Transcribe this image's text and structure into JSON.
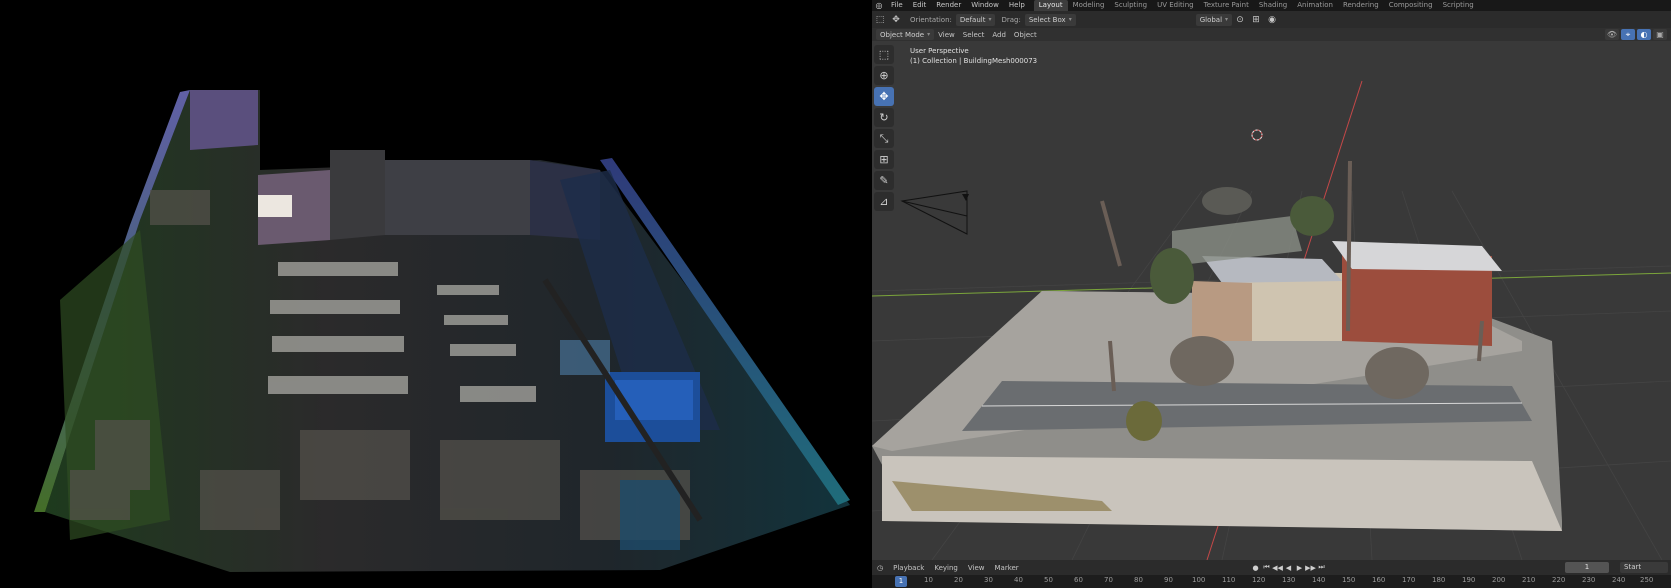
{
  "blender": {
    "menu": [
      "File",
      "Edit",
      "Render",
      "Window",
      "Help"
    ],
    "workspaces": [
      "Layout",
      "Modeling",
      "Sculpting",
      "UV Editing",
      "Texture Paint",
      "Shading",
      "Animation",
      "Rendering",
      "Compositing",
      "Scripting"
    ],
    "active_workspace": "Layout",
    "tool_header": {
      "orientation_label": "Orientation:",
      "orientation_value": "Default",
      "drag_label": "Drag:",
      "drag_value": "Select Box",
      "transform_value": "Global"
    },
    "viewport_header": {
      "mode": "Object Mode",
      "menus": [
        "View",
        "Select",
        "Add",
        "Object"
      ]
    },
    "viewport_overlay": {
      "line1": "User Perspective",
      "line2": "(1) Collection | BuildingMesh000073"
    },
    "toolbar_icons": [
      "select-box-icon",
      "cursor-icon",
      "move-icon",
      "rotate-icon",
      "scale-icon",
      "transform-icon",
      "annotate-icon",
      "measure-icon"
    ],
    "timeline": {
      "menus": [
        "Playback",
        "Keying",
        "View",
        "Marker"
      ],
      "current_frame": "1",
      "start_label": "Start",
      "start_value": "1",
      "ruler_ticks": [
        "1",
        "10",
        "20",
        "30",
        "40",
        "50",
        "60",
        "70",
        "80",
        "90",
        "100",
        "110",
        "120",
        "130",
        "140",
        "150",
        "160",
        "170",
        "180",
        "190",
        "200",
        "210",
        "220",
        "230",
        "240",
        "250"
      ]
    },
    "colors": {
      "accent": "#4772b3",
      "viewport_bg": "#393939",
      "x_axis": "#c44848",
      "y_axis": "#7ba53b"
    }
  }
}
